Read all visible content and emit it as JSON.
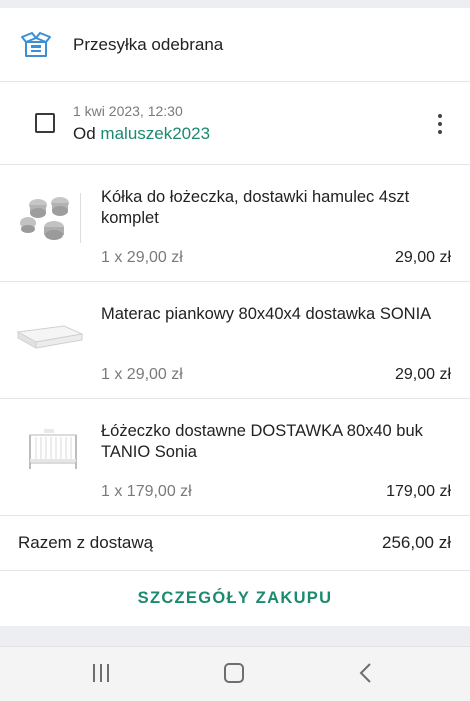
{
  "status": {
    "title": "Przesyłka odebrana",
    "icon": "open-box-icon"
  },
  "order": {
    "date": "1 kwi 2023, 12:30",
    "seller_prefix": "Od",
    "seller_name": "maluszek2023",
    "menu_icon": "more-vertical-icon"
  },
  "items": [
    {
      "name": "Kółka do łożeczka, dostawki hamulec 4szt komplet",
      "qty": "1 x 29,00 zł",
      "price": "29,00 zł",
      "thumb": "wheels-thumbnail"
    },
    {
      "name": "Materac piankowy 80x40x4 dostawka SONIA",
      "qty": "1 x 29,00 zł",
      "price": "29,00 zł",
      "thumb": "mattress-thumbnail"
    },
    {
      "name": "Łóżeczko dostawne DOSTAWKA 80x40 buk TANIO Sonia",
      "qty": "1 x 179,00 zł",
      "price": "179,00 zł",
      "thumb": "crib-thumbnail"
    }
  ],
  "total": {
    "label": "Razem z dostawą",
    "value": "256,00 zł"
  },
  "details_button": "SZCZEGÓŁY ZAKUPU",
  "navbar": {
    "recent": "recent-apps-icon",
    "home": "home-icon",
    "back": "back-icon"
  },
  "colors": {
    "accent": "#1b8a6f",
    "icon_blue": "#3a8fd6",
    "text": "#222222",
    "muted": "#7a7a7a"
  }
}
